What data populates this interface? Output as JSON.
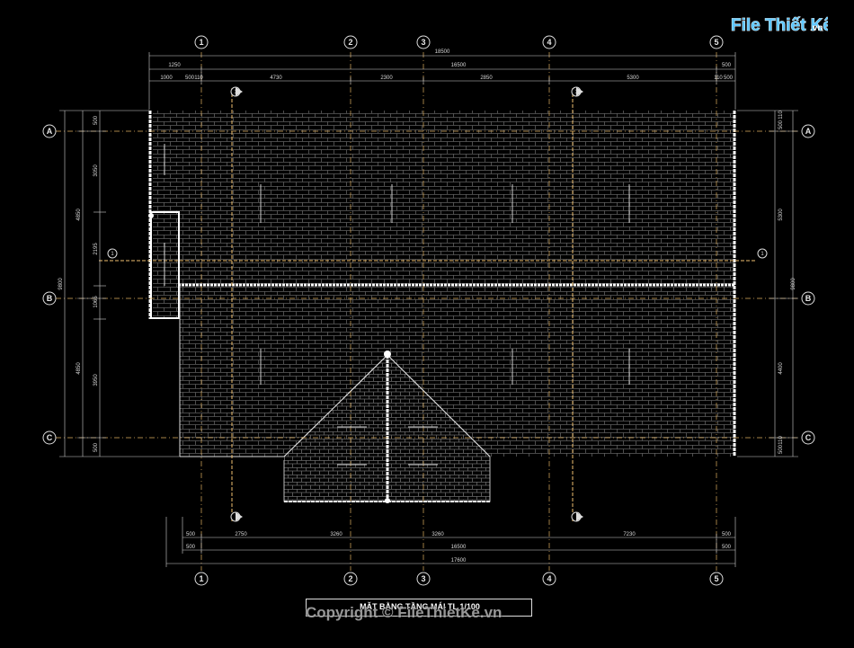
{
  "watermark": {
    "logo_text": "File Thiết Kế",
    "logo_domain": ".vn",
    "copyright": "Copyright © FileThietKe.vn",
    "logo_color": "#5fc7ff"
  },
  "drawing": {
    "title": "MẶT BẰNG TẦNG MÁI TL 1/100",
    "background": "#000000",
    "line_color": "#c8c8c8",
    "axis_color": "#e0b060"
  },
  "grid_axes": {
    "vertical": [
      "1",
      "2",
      "3",
      "4",
      "5"
    ],
    "horizontal": [
      "A",
      "B",
      "C"
    ]
  },
  "section_markers": [
    "1",
    "1",
    "1",
    "1"
  ],
  "dimensions": {
    "top_overall": "18500",
    "top_row2": [
      "1250",
      "16500",
      "500"
    ],
    "top_row3": [
      "1000",
      "500",
      "110",
      "4730",
      "2300",
      "2850",
      "5300",
      "110",
      "500"
    ],
    "bottom_row1": [
      "500",
      "2750",
      "3260",
      "3260",
      "7230",
      "500"
    ],
    "bottom_row2": [
      "500",
      "16500",
      "500"
    ],
    "bottom_overall": "17600",
    "left_outer": [
      "500",
      "3050",
      "2195",
      "1065",
      "3950",
      "500"
    ],
    "left_inner": [
      "4850",
      "9800",
      "4850"
    ],
    "right_outer": [
      "110",
      "500",
      "5300",
      "4400",
      "110",
      "500"
    ],
    "right_inner": [
      "9800"
    ]
  }
}
